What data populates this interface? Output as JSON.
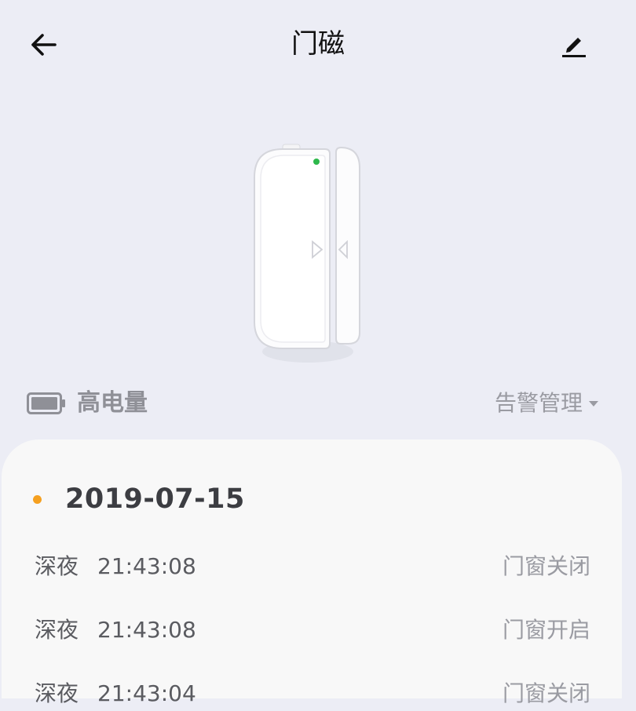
{
  "header": {
    "title": "门磁",
    "back_icon": "arrow-left-icon",
    "edit_icon": "pencil-icon"
  },
  "device": {
    "image": "door-window-sensor",
    "led_color": "#2db84b"
  },
  "status": {
    "battery_icon": "battery-full-icon",
    "battery_label": "高电量",
    "alarm_management_label": "告警管理"
  },
  "log": {
    "date": "2019-07-15",
    "date_dot_color": "#f5a020",
    "events": [
      {
        "period": "深夜",
        "time": "21:43:08",
        "state": "门窗关闭"
      },
      {
        "period": "深夜",
        "time": "21:43:08",
        "state": "门窗开启"
      },
      {
        "period": "深夜",
        "time": "21:43:04",
        "state": "门窗关闭"
      }
    ]
  }
}
